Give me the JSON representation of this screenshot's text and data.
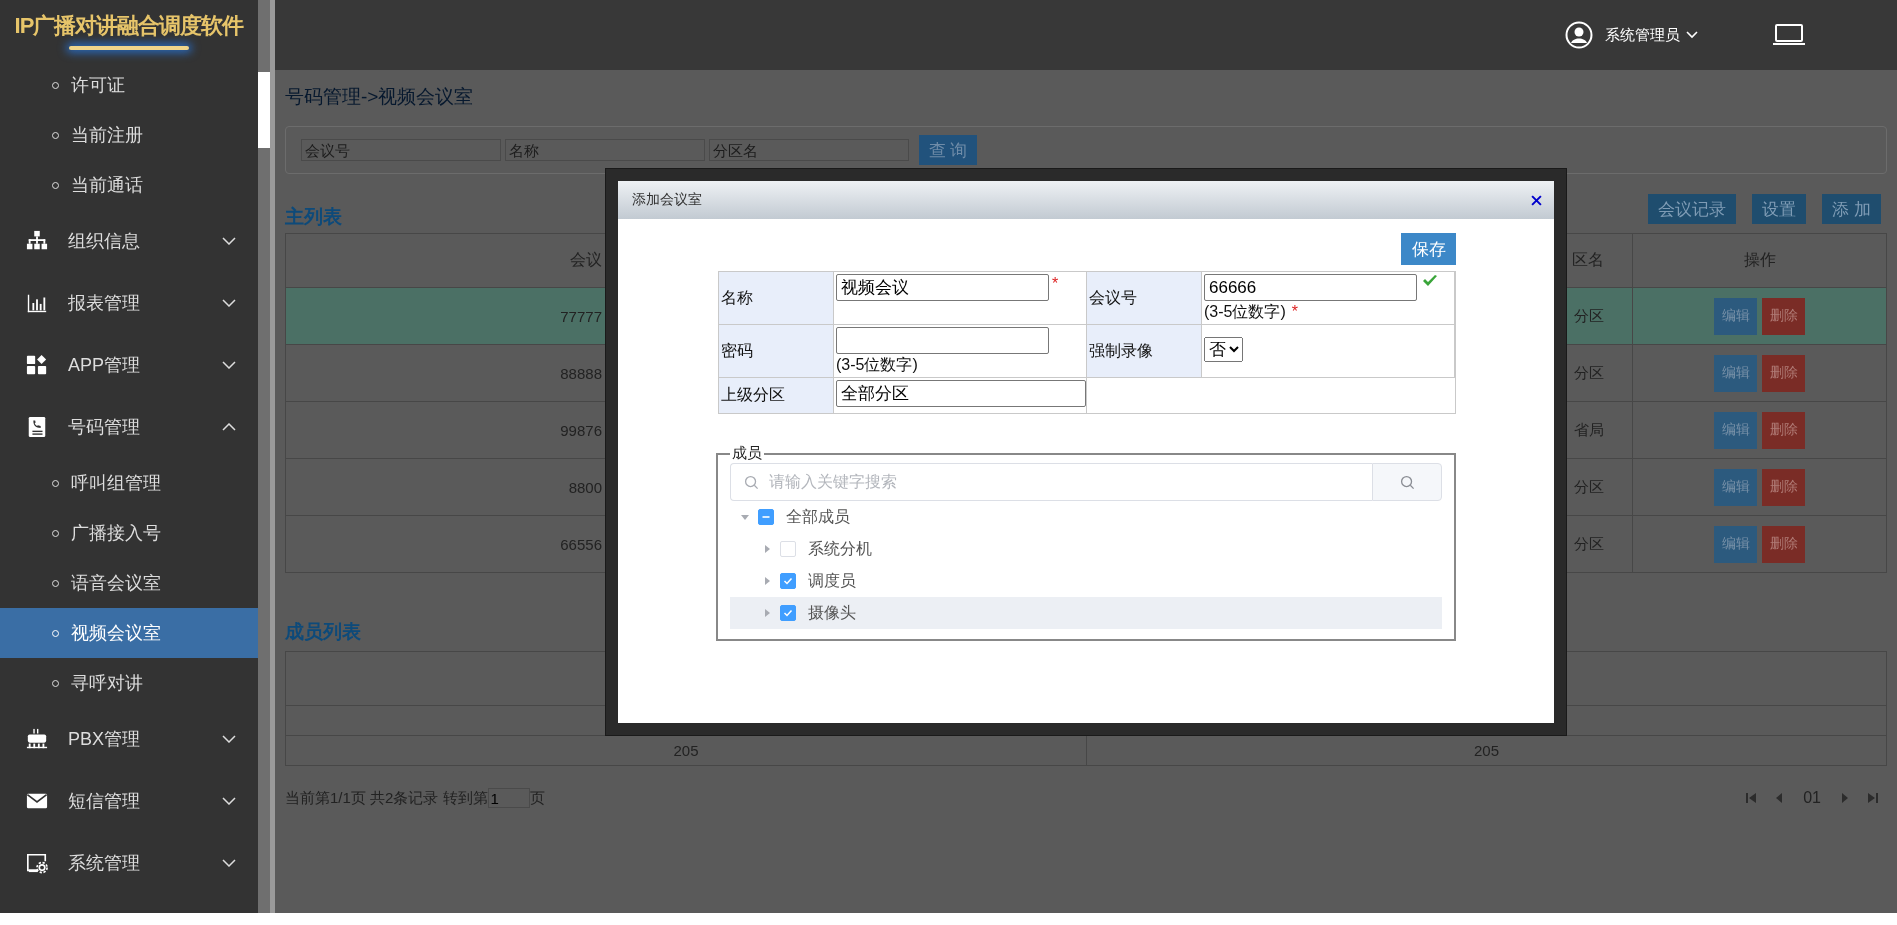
{
  "app_title": "IP广播对讲融合调度软件",
  "sidebar": {
    "items": [
      {
        "kind": "link",
        "label": "许可证",
        "selected": false
      },
      {
        "kind": "link",
        "label": "当前注册",
        "selected": false
      },
      {
        "kind": "link",
        "label": "当前通话",
        "selected": false
      },
      {
        "kind": "group",
        "label": "组织信息",
        "expanded": false
      },
      {
        "kind": "group",
        "label": "报表管理",
        "expanded": false
      },
      {
        "kind": "group",
        "label": "APP管理",
        "expanded": false
      },
      {
        "kind": "group",
        "label": "号码管理",
        "expanded": true,
        "children": [
          {
            "kind": "link",
            "label": "呼叫组管理",
            "selected": false
          },
          {
            "kind": "link",
            "label": "广播接入号",
            "selected": false
          },
          {
            "kind": "link",
            "label": "语音会议室",
            "selected": false
          },
          {
            "kind": "link",
            "label": "视频会议室",
            "selected": true
          },
          {
            "kind": "link",
            "label": "寻呼对讲",
            "selected": false
          }
        ]
      },
      {
        "kind": "group",
        "label": "PBX管理",
        "expanded": false
      },
      {
        "kind": "group",
        "label": "短信管理",
        "expanded": false
      },
      {
        "kind": "group",
        "label": "系统管理",
        "expanded": false
      }
    ]
  },
  "header": {
    "user": "系统管理员"
  },
  "breadcrumb": "号码管理->视频会议室",
  "filters": [
    {
      "placeholder": "会议号"
    },
    {
      "placeholder": "名称"
    },
    {
      "placeholder": "分区名"
    }
  ],
  "search_button": "查 询",
  "main_list": {
    "title": "主列表",
    "actions": [
      "会议记录",
      "设置",
      "添 加"
    ],
    "columns": [
      "会议",
      "区名",
      "操作"
    ],
    "rows": [
      {
        "cells": [
          "77777",
          "分区"
        ],
        "selected": true,
        "actions": [
          "编辑",
          "删除"
        ]
      },
      {
        "cells": [
          "88888",
          "分区"
        ],
        "selected": false,
        "actions": [
          "编辑",
          "删除"
        ]
      },
      {
        "cells": [
          "99876",
          "省局"
        ],
        "selected": false,
        "actions": [
          "编辑",
          "删除"
        ]
      },
      {
        "cells": [
          "8800",
          "分区"
        ],
        "selected": false,
        "actions": [
          "编辑",
          "删除"
        ]
      },
      {
        "cells": [
          "66556",
          "分区"
        ],
        "selected": false,
        "actions": [
          "编辑",
          "删除"
        ]
      }
    ]
  },
  "member_list": {
    "title": "成员列表",
    "rows": [
      {
        "cells": [
          "205",
          "205"
        ]
      }
    ]
  },
  "pagination": {
    "summary": "当前第1/1页 共2条记录 转到第",
    "page_input": "1",
    "page_suffix": "页",
    "current": "01"
  },
  "dialog": {
    "title": "添加会议室",
    "save": "保存",
    "fields": [
      {
        "kind": "text",
        "label": "名称",
        "value": "视频会议",
        "required_mark": "*"
      },
      {
        "kind": "text",
        "label": "会议号",
        "value": "66666",
        "hint": "(3-5位数字)",
        "required_mark": "*",
        "valid": true
      },
      {
        "kind": "text",
        "label": "密码",
        "hint": "(3-5位数字)"
      },
      {
        "kind": "select",
        "label": "强制录像",
        "value": "否"
      },
      {
        "kind": "text",
        "label": "上级分区",
        "value": "全部分区"
      }
    ],
    "members": {
      "legend": "成员",
      "search_placeholder": "请输入关键字搜索",
      "tree": [
        {
          "label": "全部成员",
          "expanded": true,
          "checked": false,
          "indeterminate": true,
          "selected": false,
          "children": [
            {
              "label": "系统分机",
              "expanded": false,
              "checked": false,
              "indeterminate": false,
              "selected": false
            },
            {
              "label": "调度员",
              "expanded": false,
              "checked": true,
              "indeterminate": false,
              "selected": false
            },
            {
              "label": "摄像头",
              "expanded": false,
              "checked": true,
              "indeterminate": false,
              "selected": true
            }
          ]
        }
      ]
    }
  }
}
